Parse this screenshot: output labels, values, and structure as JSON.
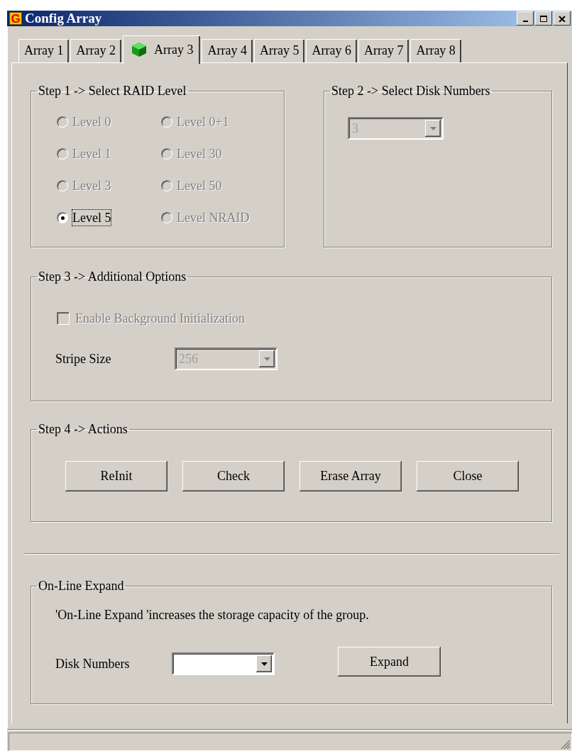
{
  "window": {
    "title": "Config Array",
    "icon_letter": "G"
  },
  "tabs": [
    {
      "label": "Array 1",
      "selected": false
    },
    {
      "label": "Array 2",
      "selected": false
    },
    {
      "label": "Array 3",
      "selected": true
    },
    {
      "label": "Array 4",
      "selected": false
    },
    {
      "label": "Array 5",
      "selected": false
    },
    {
      "label": "Array 6",
      "selected": false
    },
    {
      "label": "Array 7",
      "selected": false
    },
    {
      "label": "Array 8",
      "selected": false
    }
  ],
  "step1": {
    "title": "Step 1 -> Select RAID Level",
    "options": [
      {
        "label": "Level 0",
        "selected": false,
        "disabled": true
      },
      {
        "label": "Level 0+1",
        "selected": false,
        "disabled": true
      },
      {
        "label": "Level 1",
        "selected": false,
        "disabled": true
      },
      {
        "label": "Level 30",
        "selected": false,
        "disabled": true
      },
      {
        "label": "Level 3",
        "selected": false,
        "disabled": true
      },
      {
        "label": "Level 50",
        "selected": false,
        "disabled": true
      },
      {
        "label": "Level 5",
        "selected": true,
        "disabled": false
      },
      {
        "label": "Level NRAID",
        "selected": false,
        "disabled": true
      }
    ]
  },
  "step2": {
    "title": "Step 2 -> Select Disk Numbers",
    "disk_numbers": {
      "value": "3",
      "disabled": true
    }
  },
  "step3": {
    "title": "Step 3 -> Additional Options",
    "background_init": {
      "label": "Enable Background Initialization",
      "checked": false,
      "disabled": true
    },
    "stripe_size": {
      "label": "Stripe Size",
      "value": "256",
      "disabled": true
    }
  },
  "step4": {
    "title": "Step 4 -> Actions",
    "buttons": [
      "ReInit",
      "Check",
      "Erase Array",
      "Close"
    ]
  },
  "online_expand": {
    "title": "On-Line Expand",
    "description": "'On-Line Expand 'increases the storage capacity of the group.",
    "disk_numbers": {
      "label": "Disk Numbers",
      "disabled": false
    },
    "button": "Expand"
  }
}
